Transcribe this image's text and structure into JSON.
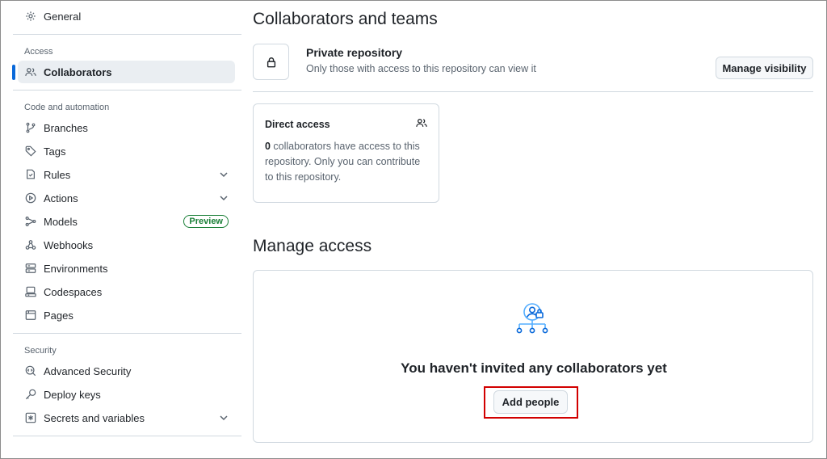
{
  "sidebar": {
    "general": "General",
    "access_section": "Access",
    "collaborators": "Collaborators",
    "code_section": "Code and automation",
    "branches": "Branches",
    "tags": "Tags",
    "rules": "Rules",
    "actions": "Actions",
    "models": "Models",
    "models_badge": "Preview",
    "webhooks": "Webhooks",
    "environments": "Environments",
    "codespaces": "Codespaces",
    "pages": "Pages",
    "security_section": "Security",
    "advanced_security": "Advanced Security",
    "deploy_keys": "Deploy keys",
    "secrets_and_variables": "Secrets and variables"
  },
  "main": {
    "title": "Collaborators and teams",
    "private_title": "Private repository",
    "private_sub": "Only those with access to this repository can view it",
    "manage_visibility": "Manage visibility",
    "direct_access_title": "Direct access",
    "direct_access_count": "0",
    "direct_access_text": " collaborators have access to this repository. Only you can contribute to this repository.",
    "manage_access_title": "Manage access",
    "empty_message": "You haven't invited any collaborators yet",
    "add_people": "Add people"
  },
  "colors": {
    "accent": "#0969da",
    "highlight": "#d20000",
    "preview_badge": "#1a7f37"
  }
}
